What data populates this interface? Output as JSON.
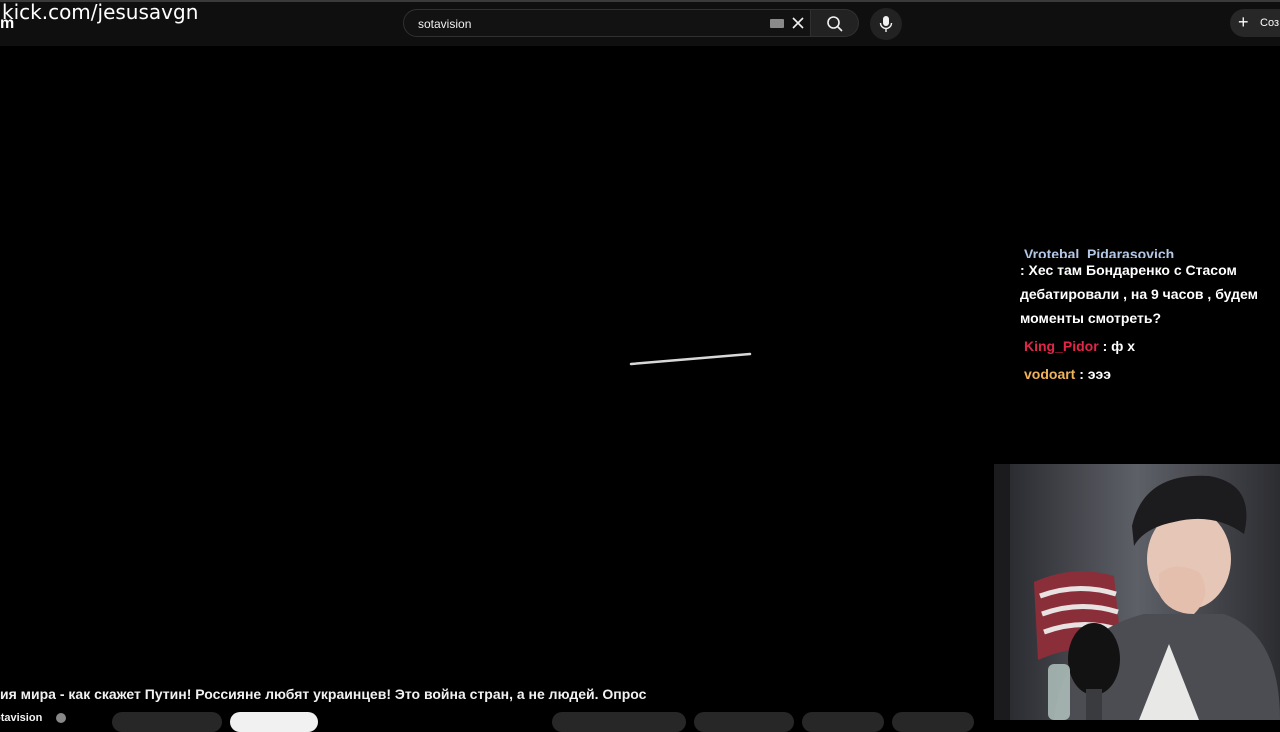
{
  "overlay": {
    "url": "kick.com/jesusavgn",
    "url_cut": "m"
  },
  "search": {
    "value": "sotavision"
  },
  "header": {
    "create_label": "Соз"
  },
  "chat": {
    "messages": [
      {
        "user": "Vrotebal_Pidarasovich",
        "user_color": "#b3c7e6",
        "text": ": Хес там Бондаренко с Стасом дебатировали , на 9 часов , будем моменты смотреть?"
      },
      {
        "user": "King_Pidor",
        "user_color": "#e0274a",
        "text": ": ф х"
      },
      {
        "user": "vodoart",
        "user_color": "#f0b35a",
        "text": ": эээ"
      }
    ]
  },
  "video": {
    "title": "ия мира - как скажет Путин! Россияне любят украинцев! Это война стран, а не людей. Опрос",
    "channel": "otavision"
  },
  "colors": {
    "page_bg": "#000000",
    "header_bg": "#0f0f0f",
    "pill_bg": "#272727"
  }
}
